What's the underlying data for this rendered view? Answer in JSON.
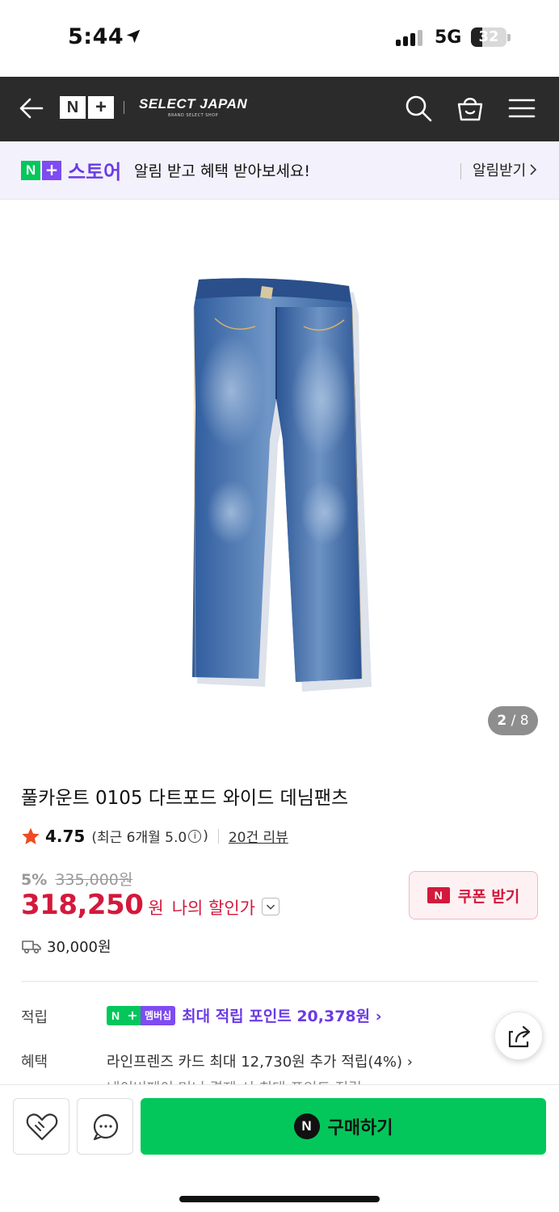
{
  "status_bar": {
    "time": "5:44",
    "network": "5G",
    "battery": "32",
    "battery_level": 0.32
  },
  "header": {
    "logo_left": "N",
    "logo_right": "+",
    "brand": "SELECT JAPAN",
    "brand_sub": "BRAND SELECT SHOP",
    "icons": [
      "back-arrow-icon",
      "search-icon",
      "shopping-bag-icon",
      "menu-icon"
    ]
  },
  "store_banner": {
    "logo_n": "N",
    "logo_plus": "+",
    "store_name": "스토어",
    "message": "알림 받고 혜택 받아보세요!",
    "action": "알림받기"
  },
  "gallery": {
    "current": "2",
    "separator": "/",
    "total": "8"
  },
  "product": {
    "title": "풀카운트 0105 다트포드 와이드 데님팬츠",
    "rating": "4.75",
    "recent_rating_prefix": "(최근 6개월 5.0",
    "recent_rating_suffix": ")",
    "info_mark": "i",
    "reviews": "20건 리뷰",
    "discount_rate": "5%",
    "original_price": "335,000원",
    "price": "318,250",
    "currency": "원",
    "my_discount": "나의 할인가",
    "coupon_label": "쿠폰 받기",
    "coupon_badge": "N",
    "shipping_fee": "30,000원"
  },
  "benefits": {
    "points_label": "적립",
    "badge_n": "N",
    "badge_plus": "+",
    "badge_text": "멤버십",
    "points_text": "최대 적립 포인트 20,378원 ›",
    "benefit_label": "혜택",
    "card_text": "라인프렌즈 카드 최대 12,730원 추가 적립(4%) ›",
    "partial_text": "네이버페이 머니 결제 시 최대 포인트 적립"
  },
  "bottom_bar": {
    "buy_badge": "N",
    "buy_label": "구매하기"
  },
  "colors": {
    "naver_green": "#03c75a",
    "plus_purple": "#7f4bf2",
    "price_red": "#d3193c",
    "header_dark": "#2b2b2b"
  }
}
